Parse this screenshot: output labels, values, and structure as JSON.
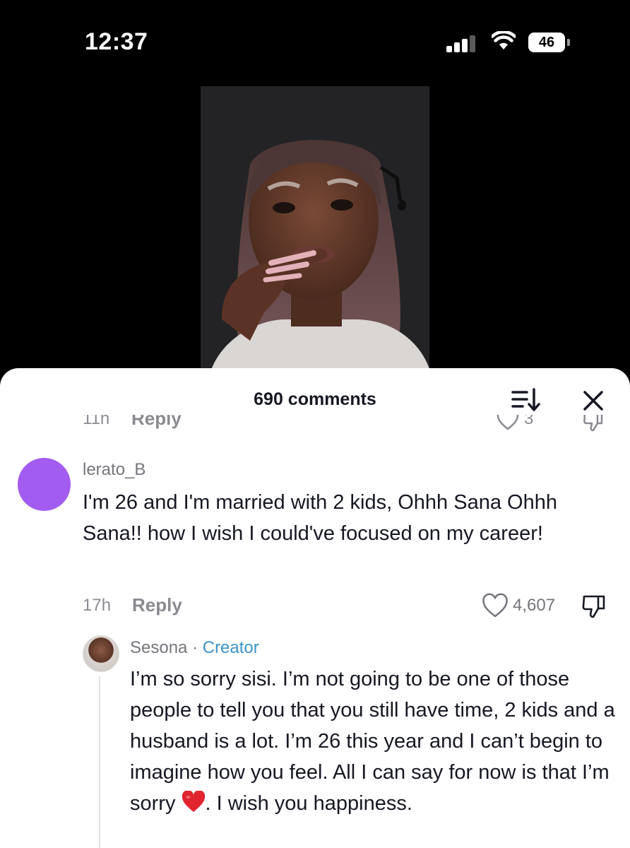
{
  "status_bar": {
    "time": "12:37",
    "battery": "46",
    "icons": [
      "cellular-signal-icon",
      "wifi-icon",
      "battery-icon"
    ]
  },
  "video": {
    "description_icon": "video-thumbnail"
  },
  "comments_sheet": {
    "title": "690 comments",
    "sort_icon": "sort-icon",
    "close_icon": "close-icon",
    "clipped_previous": {
      "time": "11h",
      "reply_label": "Reply",
      "like_count": "3"
    },
    "comment": {
      "username": "lerato_B",
      "text": "I'm 26 and I'm married with 2 kids, Ohhh Sana Ohhh Sana!! how I wish I could've focused on my career!",
      "time": "17h",
      "reply_label": "Reply",
      "like_count": "4,607",
      "avatar_color": "#a35cf0"
    },
    "reply": {
      "username": "Sesona",
      "separator": " · ",
      "badge": "Creator",
      "text_before_emoji": "I’m so sorry sisi. I’m not going to be one of those people to tell you that you still have time, 2 kids and a husband is a lot. I’m 26 this year and I can’t begin to imagine how you feel. All I can say for now is that I’m sorry ",
      "emoji": "red-heart-icon",
      "text_after_emoji": ". I wish you happiness.",
      "badge_color": "#3e93c9"
    }
  }
}
